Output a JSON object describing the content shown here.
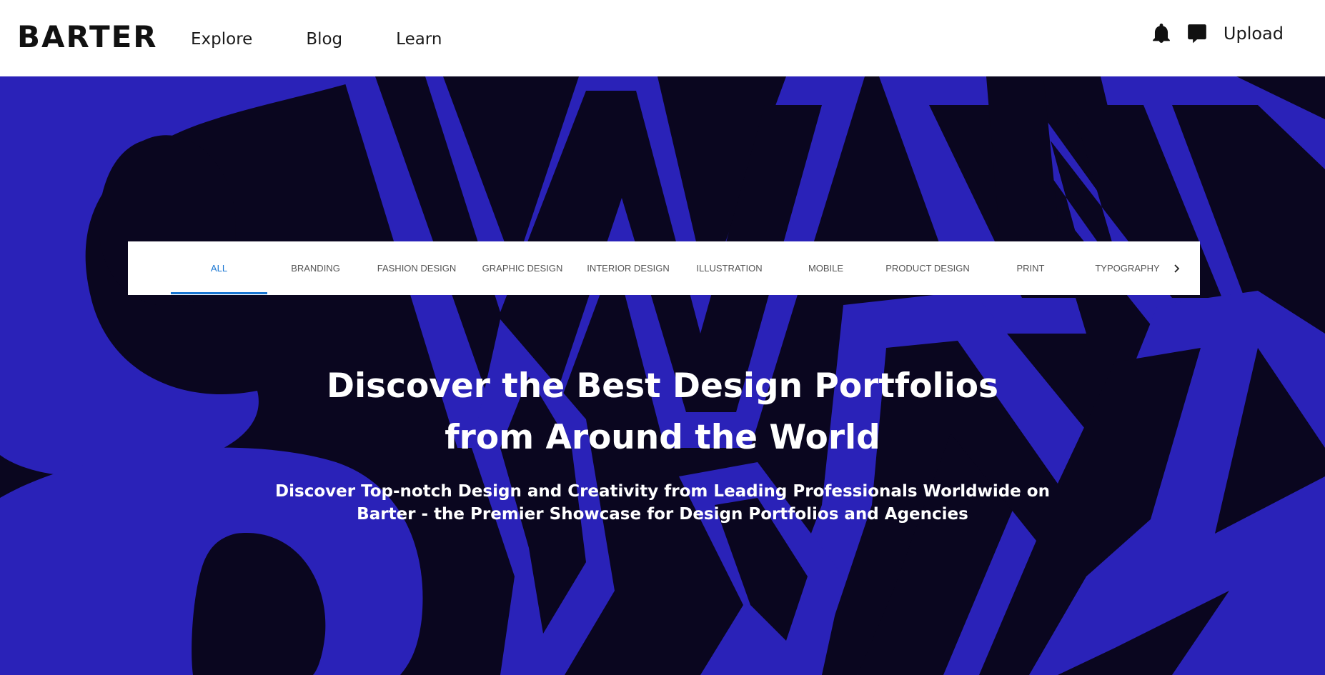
{
  "header": {
    "logo": "BARTER",
    "nav": [
      "Explore",
      "Blog",
      "Learn"
    ],
    "icons": [
      "bell-icon",
      "chat-icon"
    ],
    "upload_label": "Upload"
  },
  "categories": {
    "tabs": [
      "ALL",
      "BRANDING",
      "FASHION DESIGN",
      "GRAPHIC DESIGN",
      "INTERIOR DESIGN",
      "ILLUSTRATION",
      "MOBILE",
      "PRODUCT DESIGN",
      "PRINT",
      "TYPOGRAPHY"
    ],
    "active": "ALL",
    "next_icon": "chevron-right-icon"
  },
  "hero": {
    "title_line1": "Discover the Best Design Portfolios",
    "title_line2": "from Around the World",
    "subtitle_line1": "Discover Top-notch Design and Creativity from Leading Professionals Worldwide on",
    "subtitle_line2": "Barter - the Premier Showcase for Design Portfolios and Agencies"
  },
  "colors": {
    "accent": "#1976d2",
    "hero_dark": "#0a061f",
    "hero_blue": "#2a22b8",
    "text_dark": "#1a1a1a"
  }
}
